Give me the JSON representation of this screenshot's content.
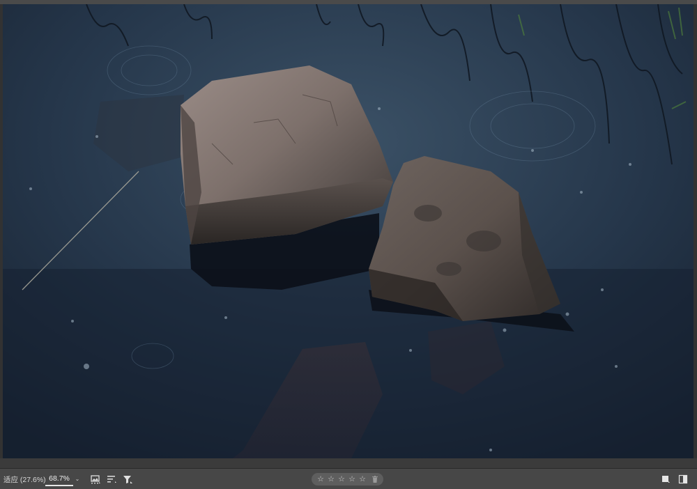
{
  "canvas": {
    "description_icon": "photo-canvas"
  },
  "bottom_bar": {
    "fit_label": "适应 (27.6%)",
    "zoom_value": "68.7%",
    "zoom_caret": "⌄",
    "tools": [
      {
        "name": "image-display-icon"
      },
      {
        "name": "sort-icon"
      },
      {
        "name": "filter-icon"
      }
    ],
    "rating": {
      "stars": [
        "☆",
        "☆",
        "☆",
        "☆",
        "☆"
      ],
      "delete_icon": "trash-icon"
    },
    "view_icons": [
      {
        "name": "single-view-icon"
      },
      {
        "name": "split-view-icon"
      }
    ]
  },
  "colors": {
    "bar_background": "#474747",
    "pill_background": "#5e5e5e",
    "water_dark": "#1c2a3b"
  }
}
